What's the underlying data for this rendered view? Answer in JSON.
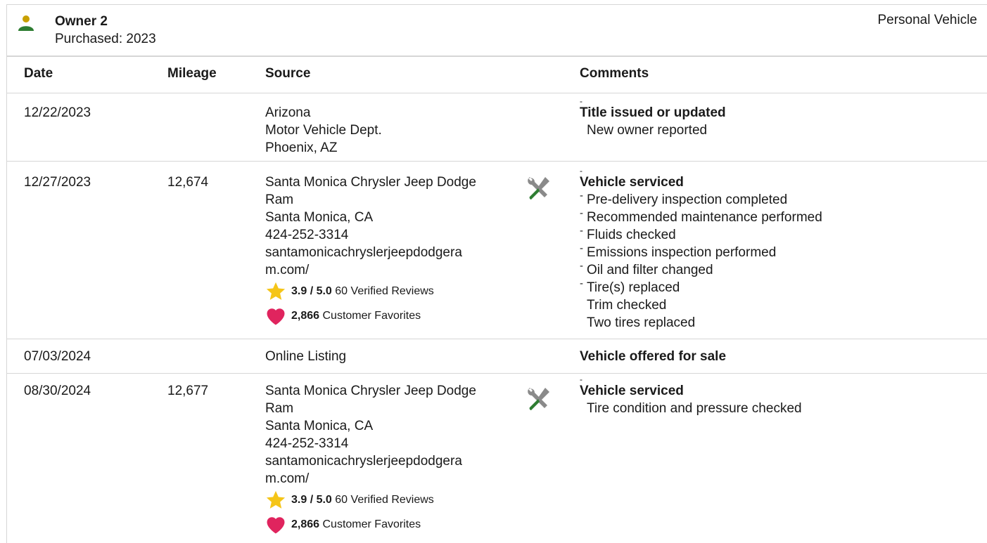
{
  "owner": {
    "name": "Owner 2",
    "purchased": "Purchased: 2023",
    "vehicle_type": "Personal Vehicle",
    "icon": "person-icon",
    "icon_color": "#2e7d32"
  },
  "columns": {
    "date": "Date",
    "mileage": "Mileage",
    "source": "Source",
    "comments": "Comments"
  },
  "rows": [
    {
      "date": "12/22/2023",
      "mileage": "",
      "source": [
        "Arizona",
        "Motor Vehicle Dept.",
        "Phoenix, AZ"
      ],
      "comments_title": "Title issued or updated",
      "comments": [
        "New owner reported"
      ]
    },
    {
      "date": "12/27/2023",
      "mileage": "12,674",
      "source": [
        "Santa Monica Chrysler Jeep Dodge",
        "Ram",
        "Santa Monica, CA",
        "424-252-3314",
        "santamonicachryslerjeepdodgera",
        "m.com/"
      ],
      "rating": "3.9 / 5.0",
      "reviews": "60 Verified Reviews",
      "favorites": "2,866",
      "favorites_label": "Customer Favorites",
      "comments_title": "Vehicle serviced",
      "comments": [
        "Pre-delivery inspection completed",
        "Recommended maintenance performed",
        "Fluids checked",
        "Emissions inspection performed",
        "Oil and filter changed",
        "Tire(s) replaced",
        "Trim checked",
        "Two tires replaced"
      ]
    },
    {
      "date": "07/03/2024",
      "mileage": "",
      "source": [
        "Online Listing"
      ],
      "comments_title": "Vehicle offered for sale",
      "comments": []
    },
    {
      "date": "08/30/2024",
      "mileage": "12,677",
      "source": [
        "Santa Monica Chrysler Jeep Dodge",
        "Ram",
        "Santa Monica, CA",
        "424-252-3314",
        "santamonicachryslerjeepdodgera",
        "m.com/"
      ],
      "rating": "3.9 / 5.0",
      "reviews": "60 Verified Reviews",
      "favorites": "2,866",
      "favorites_label": "Customer Favorites",
      "comments_title": "Vehicle serviced",
      "comments": [
        "Tire condition and pressure checked"
      ]
    }
  ],
  "colors": {
    "border": "#d6d6d6",
    "star": "#f5c518",
    "heart": "#e0245e",
    "wrench_gray": "#8a8a8a",
    "wrench_green": "#2e7d32"
  }
}
